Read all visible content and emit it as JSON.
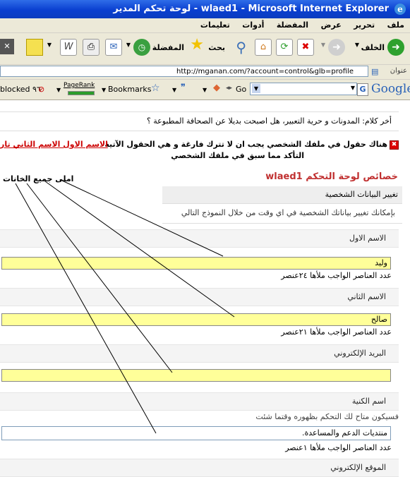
{
  "window": {
    "title": "wlaed1 - Microsoft Internet Explorer - لوحة تحكم المدير"
  },
  "menu": [
    "ملف",
    "تحرير",
    "عرض",
    "المفضلة",
    "أدوات",
    "تعليمات"
  ],
  "toolbar": {
    "back_label": "الخلف",
    "search_label": "بحث",
    "favorites_label": "المفضلة"
  },
  "address": {
    "label": "عنوان",
    "url": "http://mganan.com/?account=control&glb=profile"
  },
  "google_bar": {
    "go_label": "Go",
    "bookmarks_label": "Bookmarks",
    "pagerank_label": "PageRank",
    "blocked_label": "blocked ٩٦",
    "brand": "Google"
  },
  "content": {
    "notice": "أخر كلام: المدونات و حرية التعبير، هل اصبحت بديلا عن الصحافة المطبوعة ؟",
    "error_line1": "هناك حقول في ملفك الشخصي يجب ان لا تترك فارغة و هي الحقول الآتية",
    "error_fields": "الاسم الاول الاسم الثاني تار",
    "error_line2": "التأكد مما سبق في ملفك الشخصي",
    "panel_title": "خصائص لوحة التحكم wlaed1",
    "section_title": "تغيير البيانات الشخصية",
    "section_desc": "بإمكانك تغيير بياناتك الشخصية في اي وقت من خلال النموذج التالي",
    "annotation": "املى جميع الخانات",
    "fields": [
      {
        "label": "الاسم الاول",
        "value": "وليد",
        "count": "عدد العناصر الواجب ملأها ٢٤عنصر"
      },
      {
        "label": "الاسم الثاني",
        "value": "صالح",
        "count": "عدد العناصر الواجب ملأها ٢١عنصر"
      },
      {
        "label": "البريد الإلكتروني",
        "value": "",
        "count": ""
      },
      {
        "label": "اسم الكنية",
        "value": "منتديات الدعم والمساعدة.",
        "count": "عدد العناصر الواجب ملأها ١عنصر",
        "hint": "فسيكون متاح لك التحكم بظهوره وقتما شئت"
      }
    ],
    "last_label": "الموقع الإلكتروني"
  }
}
